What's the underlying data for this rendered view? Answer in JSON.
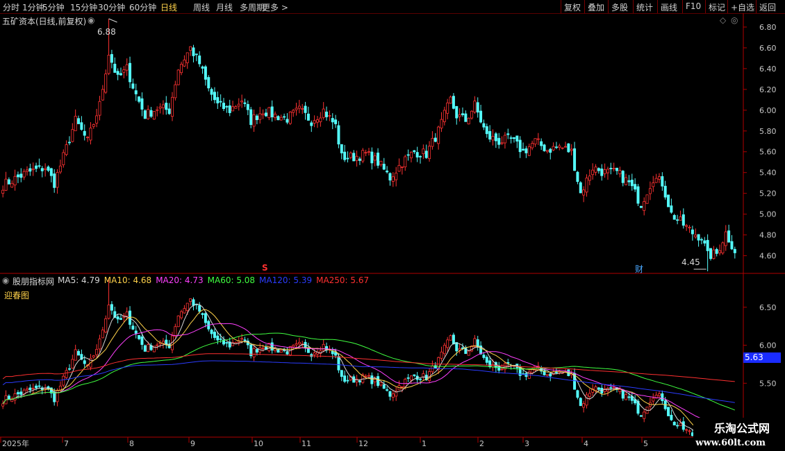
{
  "toolbar": {
    "left": [
      {
        "label": "分时",
        "active": false
      },
      {
        "label": "1分钟",
        "active": false
      },
      {
        "label": "5分钟",
        "active": false
      },
      {
        "label": "15分钟",
        "active": false
      },
      {
        "label": "30分钟",
        "active": false
      },
      {
        "label": "60分钟",
        "active": false
      },
      {
        "label": "日线",
        "active": true
      },
      {
        "label": "周线",
        "active": false
      },
      {
        "label": "月线",
        "active": false
      },
      {
        "label": "多周期",
        "active": false
      },
      {
        "label": "更多 >",
        "active": false
      }
    ],
    "right": [
      "复权",
      "叠加",
      "多股",
      "统计",
      "画线",
      "F10",
      "标记",
      "+自选",
      "返回"
    ]
  },
  "main_panel": {
    "title": "五矿资本(日线,前复权)",
    "high_label": "6.88",
    "low_label": "4.45",
    "markers": [
      {
        "text": "S",
        "color": "#ff3030"
      },
      {
        "text": "财",
        "color": "#4aa8ff"
      }
    ]
  },
  "indicator_panel": {
    "title": "股朋指标网",
    "subtitle": "迎春图",
    "ma_labels": [
      {
        "text": "MA5: 4.79",
        "color": "#d8d8d8"
      },
      {
        "text": "MA10: 4.68",
        "color": "#ffd24a"
      },
      {
        "text": "MA20: 4.73",
        "color": "#ff40ff"
      },
      {
        "text": "MA60: 5.08",
        "color": "#40ff40"
      },
      {
        "text": "MA120: 5.39",
        "color": "#2b3cff"
      },
      {
        "text": "MA250: 5.67",
        "color": "#ff3030"
      }
    ],
    "current_price_tag": "5.63"
  },
  "x_axis": [
    "2025年",
    "7",
    "8",
    "9",
    "10",
    "11",
    "12",
    "1",
    "2",
    "3",
    "4",
    "5"
  ],
  "watermark": {
    "line1": "乐淘公式网",
    "line2": "www.60lt.com"
  },
  "colors": {
    "up": "#ff3232",
    "down": "#54fcfc",
    "axis": "#b00000",
    "text": "#c8c8c8"
  },
  "chart_data": {
    "type": "candlestick",
    "main_ylim": [
      4.45,
      6.92
    ],
    "main_yticks": [
      4.6,
      4.8,
      5.0,
      5.2,
      5.4,
      5.6,
      5.8,
      6.0,
      6.2,
      6.4,
      6.6,
      6.8
    ],
    "indicator_ylim": [
      4.8,
      6.9
    ],
    "indicator_yticks": [
      5.0,
      5.5,
      6.0,
      6.5
    ],
    "price_anchors": [
      [
        0,
        5.28
      ],
      [
        8,
        5.4
      ],
      [
        14,
        5.45
      ],
      [
        17,
        5.3
      ],
      [
        20,
        5.55
      ],
      [
        24,
        5.9
      ],
      [
        28,
        5.7
      ],
      [
        32,
        6.05
      ],
      [
        35,
        6.55
      ],
      [
        38,
        6.3
      ],
      [
        41,
        6.4
      ],
      [
        44,
        6.15
      ],
      [
        47,
        5.95
      ],
      [
        51,
        6.02
      ],
      [
        55,
        6.0
      ],
      [
        58,
        6.4
      ],
      [
        62,
        6.6
      ],
      [
        65,
        6.45
      ],
      [
        68,
        6.2
      ],
      [
        71,
        6.05
      ],
      [
        75,
        6.0
      ],
      [
        79,
        6.1
      ],
      [
        82,
        5.9
      ],
      [
        86,
        6.0
      ],
      [
        90,
        5.95
      ],
      [
        94,
        5.92
      ],
      [
        98,
        6.0
      ],
      [
        102,
        5.9
      ],
      [
        106,
        6.0
      ],
      [
        110,
        5.85
      ],
      [
        112,
        5.55
      ],
      [
        116,
        5.55
      ],
      [
        120,
        5.58
      ],
      [
        124,
        5.5
      ],
      [
        128,
        5.35
      ],
      [
        132,
        5.5
      ],
      [
        136,
        5.6
      ],
      [
        140,
        5.58
      ],
      [
        144,
        5.8
      ],
      [
        148,
        6.1
      ],
      [
        150,
        5.95
      ],
      [
        153,
        5.9
      ],
      [
        156,
        6.05
      ],
      [
        160,
        5.75
      ],
      [
        164,
        5.7
      ],
      [
        168,
        5.72
      ],
      [
        172,
        5.6
      ],
      [
        176,
        5.7
      ],
      [
        180,
        5.62
      ],
      [
        184,
        5.65
      ],
      [
        188,
        5.6
      ],
      [
        191,
        5.2
      ],
      [
        195,
        5.45
      ],
      [
        199,
        5.4
      ],
      [
        203,
        5.4
      ],
      [
        207,
        5.3
      ],
      [
        211,
        5.1
      ],
      [
        215,
        5.35
      ],
      [
        218,
        5.3
      ],
      [
        221,
        5.0
      ],
      [
        225,
        4.9
      ],
      [
        228,
        4.82
      ],
      [
        231,
        4.78
      ],
      [
        233,
        4.6
      ],
      [
        236,
        4.62
      ],
      [
        239,
        4.82
      ],
      [
        242,
        4.65
      ]
    ],
    "num_candles": 243,
    "high_point": {
      "index": 35,
      "value": 6.88
    },
    "low_point": {
      "index": 233,
      "value": 4.45
    },
    "ma_periods": [
      5,
      10,
      20,
      60,
      120,
      250
    ]
  }
}
